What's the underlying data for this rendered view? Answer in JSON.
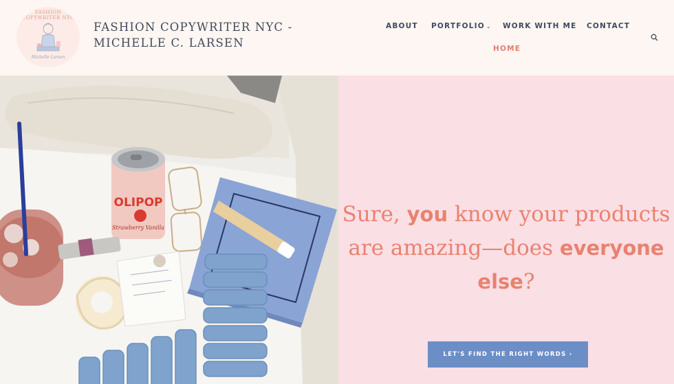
{
  "site": {
    "logo_ring_text": "FASHION COPYWRITER NYC",
    "logo_signature": "Michelle Larsen",
    "title": "FASHION COPYWRITER NYC - MICHELLE C. LARSEN"
  },
  "nav": {
    "about": "ABOUT",
    "portfolio": "PORTFOLIO",
    "portfolio_chevron": "⌄",
    "work_with_me": "WORK WITH ME",
    "contact": "CONTACT",
    "home": "HOME"
  },
  "hero": {
    "headline_parts": {
      "p1": "Sure, ",
      "p2": "you",
      "p3": " know your products are amazing—does ",
      "p4": "everyone else",
      "p5": "?"
    },
    "cta_label": "LET'S FIND THE RIGHT WORDS ›",
    "can_text": "OLIPOP",
    "can_flavor": "Strawberry Vanilla"
  },
  "colors": {
    "accent_coral": "#e9826f",
    "nav_text": "#3f4a5e",
    "panel_pink": "#fadfe5",
    "cta_blue": "#6b8ec6",
    "header_bg": "#fdf6f2"
  }
}
